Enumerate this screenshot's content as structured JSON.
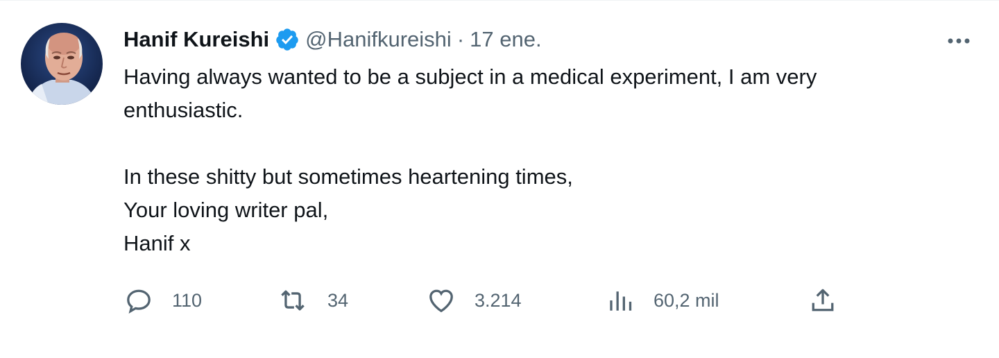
{
  "author": {
    "name": "Hanif Kureishi",
    "verified_icon": "verified-badge-icon",
    "handle": "@Hanifkureishi",
    "separator": "·",
    "time": "17 ene.",
    "avatar_icon": "avatar-portrait"
  },
  "more_icon": "more-options-icon",
  "tweet": {
    "line1": "Having always wanted to be a subject in a medical experiment, I am very",
    "line2": "enthusiastic.",
    "line3": "In these shitty but sometimes heartening times,",
    "line4": "Your loving writer pal,",
    "line5": "Hanif x"
  },
  "actions": {
    "reply": {
      "icon": "reply-icon",
      "count": "110"
    },
    "retweet": {
      "icon": "retweet-icon",
      "count": "34"
    },
    "like": {
      "icon": "heart-icon",
      "count": "3.214"
    },
    "views": {
      "icon": "views-chart-icon",
      "count": "60,2 mil"
    },
    "share": {
      "icon": "share-icon"
    }
  },
  "colors": {
    "verified_blue": "#1d9bf0",
    "secondary_text": "#536471",
    "primary_text": "#0f1419"
  }
}
